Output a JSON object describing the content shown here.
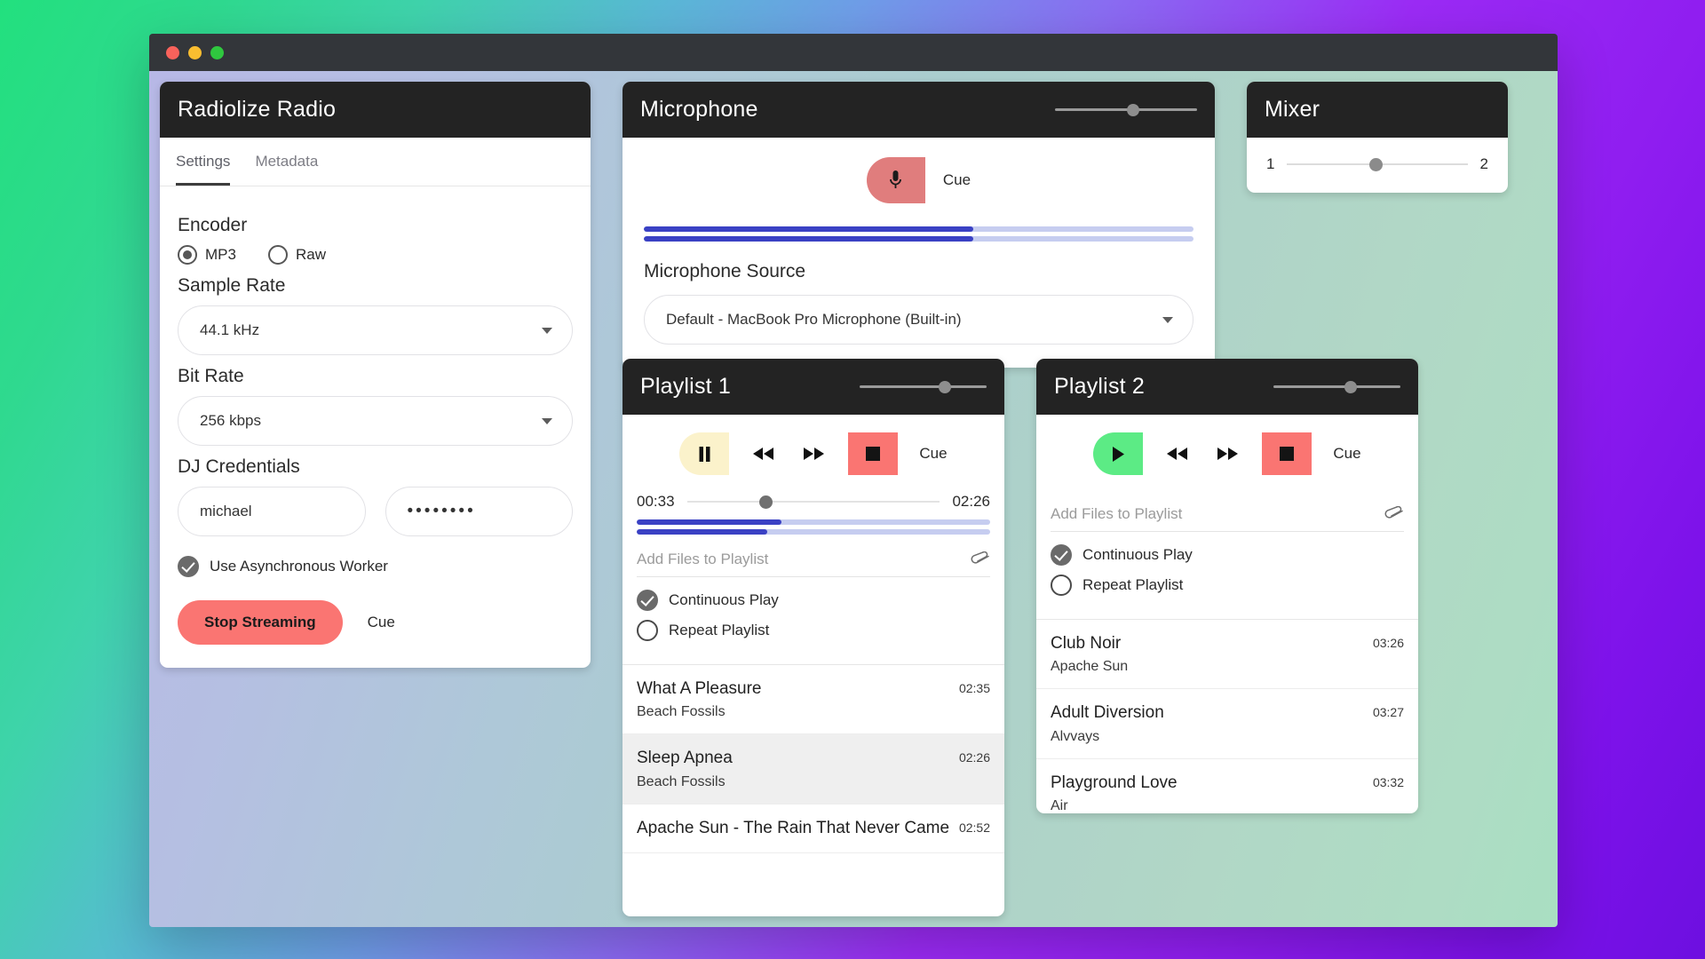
{
  "window": {
    "traffic_lights": [
      "close",
      "minimize",
      "zoom"
    ]
  },
  "settings": {
    "title": "Radiolize Radio",
    "tabs": [
      {
        "label": "Settings",
        "active": true
      },
      {
        "label": "Metadata",
        "active": false
      }
    ],
    "encoder": {
      "label": "Encoder",
      "options": [
        {
          "label": "MP3",
          "selected": true
        },
        {
          "label": "Raw",
          "selected": false
        }
      ]
    },
    "sample_rate": {
      "label": "Sample Rate",
      "value": "44.1 kHz"
    },
    "bit_rate": {
      "label": "Bit Rate",
      "value": "256 kbps"
    },
    "dj_credentials": {
      "label": "DJ Credentials",
      "username": "michael",
      "password": "••••••••"
    },
    "async_worker": {
      "label": "Use Asynchronous Worker",
      "checked": true
    },
    "stop_button": "Stop Streaming",
    "cue_label": "Cue"
  },
  "microphone": {
    "title": "Microphone",
    "volume_percent": 55,
    "cue_label": "Cue",
    "mic_icon": "microphone-icon",
    "meters": [
      60,
      60
    ],
    "source_label": "Microphone Source",
    "source_value": "Default - MacBook Pro Microphone (Built-in)"
  },
  "mixer": {
    "title": "Mixer",
    "left_label": "1",
    "right_label": "2",
    "value_percent": 49
  },
  "playlist1": {
    "title": "Playlist 1",
    "volume_percent": 67,
    "transport": {
      "play_pause": "pause",
      "rewind": "rewind-icon",
      "forward": "fast-forward-icon",
      "stop": "stop-icon",
      "cue_label": "Cue"
    },
    "elapsed": "00:33",
    "duration": "02:26",
    "position_percent": 31,
    "meters": [
      41,
      37
    ],
    "add_files": "Add Files to Playlist",
    "attach_icon": "paperclip-icon",
    "options": [
      {
        "label": "Continuous Play",
        "checked": true
      },
      {
        "label": "Repeat Playlist",
        "checked": false
      }
    ],
    "tracks": [
      {
        "title": "What A Pleasure",
        "artist": "Beach Fossils",
        "time": "02:35",
        "selected": false
      },
      {
        "title": "Sleep Apnea",
        "artist": "Beach Fossils",
        "time": "02:26",
        "selected": true
      },
      {
        "title": "Apache Sun - The Rain That Never Came",
        "artist": "",
        "time": "02:52",
        "selected": false
      }
    ]
  },
  "playlist2": {
    "title": "Playlist 2",
    "volume_percent": 61,
    "transport": {
      "play_pause": "play",
      "rewind": "rewind-icon",
      "forward": "fast-forward-icon",
      "stop": "stop-icon",
      "cue_label": "Cue"
    },
    "add_files": "Add Files to Playlist",
    "attach_icon": "paperclip-icon",
    "options": [
      {
        "label": "Continuous Play",
        "checked": true
      },
      {
        "label": "Repeat Playlist",
        "checked": false
      }
    ],
    "tracks": [
      {
        "title": "Club Noir",
        "artist": "Apache Sun",
        "time": "03:26",
        "selected": false
      },
      {
        "title": "Adult Diversion",
        "artist": "Alvvays",
        "time": "03:27",
        "selected": false
      },
      {
        "title": "Playground Love",
        "artist": "Air",
        "time": "03:32",
        "selected": false
      }
    ]
  },
  "colors": {
    "panel_header": "#232323",
    "accent_red": "#fa7572",
    "accent_green": "#5ceb85",
    "accent_cream": "#fbf2cb",
    "meter_fill": "#3a41c4",
    "meter_track": "#c6cdf0"
  }
}
